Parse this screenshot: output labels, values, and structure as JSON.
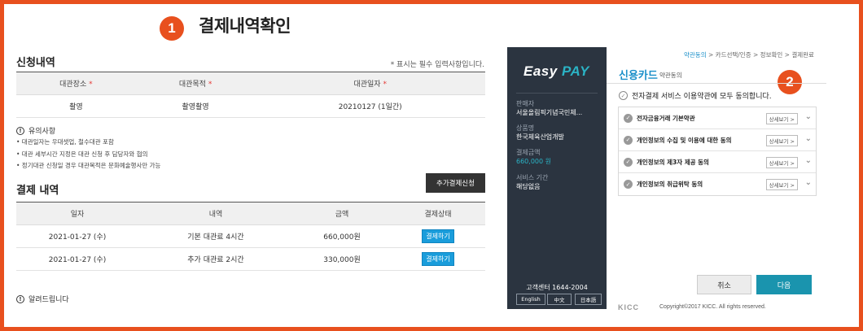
{
  "colors": {
    "accent": "#e8501e",
    "blue": "#1a9ddb",
    "teal": "#1a94ae",
    "panel": "#2b3440"
  },
  "steps": {
    "one": "1",
    "two": "2"
  },
  "page_title": "결제내역확인",
  "application": {
    "title": "신청내역",
    "required_note": "* 표시는 필수 입력사항입니다.",
    "headers": [
      "대관장소",
      "대관목적",
      "대관일자"
    ],
    "row": [
      "촬영",
      "촬영촬영",
      "20210127 (1일간)"
    ]
  },
  "notice": {
    "title": "유의사항",
    "items": [
      "• 대관일자는 우대샛업, 철수대관 포함",
      "• 대관 세부시간 지정은 대관 신청 후 담당자와 협의",
      "• 정기대관 신청일 경우 대관목적은 문화예술행사만 가능"
    ]
  },
  "add_payment_label": "추가결제신청",
  "payment": {
    "title": "결제 내역",
    "headers": [
      "일자",
      "내역",
      "금액",
      "결제상태"
    ],
    "rows": [
      {
        "date": "2021-01-27 (수)",
        "desc": "기본 대관료 4시간",
        "amount": "660,000원",
        "status": "결제하기"
      },
      {
        "date": "2021-01-27 (수)",
        "desc": "추가 대관료 2시간",
        "amount": "330,000원",
        "status": "결제하기"
      }
    ]
  },
  "bottom_notice": "알려드립니다",
  "easypay": {
    "logo_easy": "Easy",
    "logo_pay": "PAY",
    "seller_label": "판매자",
    "seller_value": "서울올림픽기념국민체...",
    "product_label": "상품명",
    "product_value": "한국체육산업개발",
    "amount_label": "결제금액",
    "amount_value": "660,000 원",
    "period_label": "서비스 기간",
    "period_value": "해당없음",
    "customer_center": "고객센터 1644-2004",
    "languages": [
      "English",
      "中文",
      "日本語"
    ]
  },
  "breadcrumb": [
    "약관동의",
    "카드선택/인증",
    "정보확인",
    "결제완료"
  ],
  "card": {
    "title": "신용카드",
    "subtitle": "약관동의",
    "agree_all": "전자결제 서비스 이용약관에 모두 동의합니다.",
    "terms": [
      "전자금융거래 기본약관",
      "개인정보의 수집 및 이용에 대한 동의",
      "개인정보의 제3자 제공 동의",
      "개인정보의 취급위탁 동의"
    ],
    "detail_label": "상세보기 >",
    "cancel": "취소",
    "next": "다음",
    "brand": "KICC",
    "copyright": "Copyright©2017 KICC. All rights reserved."
  }
}
